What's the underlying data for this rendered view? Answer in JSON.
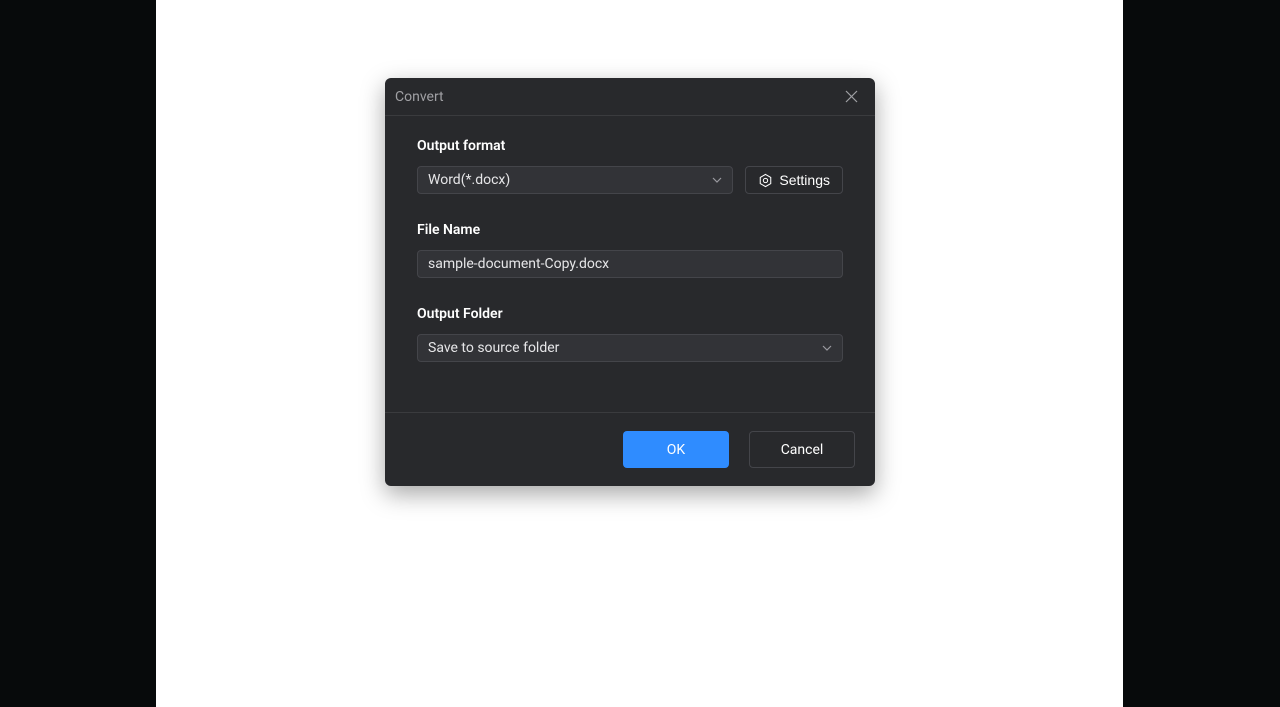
{
  "dialog": {
    "title": "Convert",
    "output_format": {
      "label": "Output format",
      "value": "Word(*.docx)"
    },
    "settings_label": "Settings",
    "file_name": {
      "label": "File Name",
      "value": "sample-document-Copy.docx"
    },
    "output_folder": {
      "label": "Output Folder",
      "value": "Save to source folder"
    },
    "buttons": {
      "ok": "OK",
      "cancel": "Cancel"
    }
  }
}
